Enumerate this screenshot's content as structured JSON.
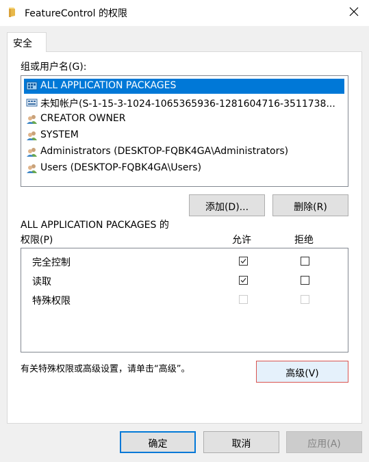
{
  "window": {
    "title": "FeatureControl 的权限",
    "close_glyph": "✕"
  },
  "tabs": [
    {
      "label": "安全"
    }
  ],
  "groups": {
    "label": "组或用户名(G):",
    "items": [
      {
        "name": "ALL APPLICATION PACKAGES",
        "icon": "app-packages-icon",
        "selected": true
      },
      {
        "name": "未知帐户(S-1-15-3-1024-1065365936-1281604716-3511738...",
        "icon": "unknown-account-icon",
        "selected": false
      },
      {
        "name": "CREATOR OWNER",
        "icon": "user-group-icon",
        "selected": false
      },
      {
        "name": "SYSTEM",
        "icon": "user-group-icon",
        "selected": false
      },
      {
        "name": "Administrators (DESKTOP-FQBK4GA\\Administrators)",
        "icon": "user-group-icon",
        "selected": false
      },
      {
        "name": "Users (DESKTOP-FQBK4GA\\Users)",
        "icon": "user-group-icon",
        "selected": false
      }
    ],
    "add_label": "添加(D)...",
    "remove_label": "删除(R)"
  },
  "permissions": {
    "title": "ALL APPLICATION PACKAGES 的",
    "label": "权限(P)",
    "allow_header": "允许",
    "deny_header": "拒绝",
    "rows": [
      {
        "name": "完全控制",
        "allow": true,
        "deny": false,
        "enabled": true
      },
      {
        "name": "读取",
        "allow": true,
        "deny": false,
        "enabled": true
      },
      {
        "name": "特殊权限",
        "allow": false,
        "deny": false,
        "enabled": false
      }
    ]
  },
  "advanced": {
    "hint": "有关特殊权限或高级设置，请单击“高级”。",
    "button_label": "高级(V)"
  },
  "footer": {
    "ok_label": "确定",
    "cancel_label": "取消",
    "apply_label": "应用(A)"
  },
  "colors": {
    "selection": "#0078d7",
    "panel": "#ffffff",
    "dialog_bg": "#f0f0f0"
  }
}
